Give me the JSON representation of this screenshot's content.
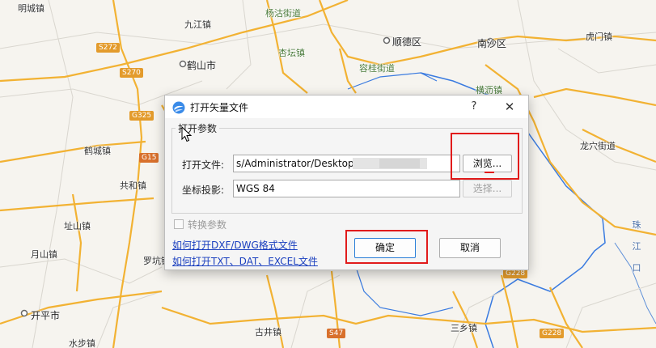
{
  "map": {
    "labels": [
      {
        "text": "明城镇",
        "cls": ""
      },
      {
        "text": "九江镇",
        "cls": ""
      },
      {
        "text": "杨沽街道",
        "cls": "green"
      },
      {
        "text": "顺德区",
        "cls": "big"
      },
      {
        "text": "南沙区",
        "cls": "big"
      },
      {
        "text": "虎门镇",
        "cls": ""
      },
      {
        "text": "鹤山市",
        "cls": "big"
      },
      {
        "text": "杏坛镇",
        "cls": "green"
      },
      {
        "text": "容桂街道",
        "cls": "green"
      },
      {
        "text": "横沥镇",
        "cls": "green"
      },
      {
        "text": "鹤城镇",
        "cls": ""
      },
      {
        "text": "共和镇",
        "cls": ""
      },
      {
        "text": "址山镇",
        "cls": ""
      },
      {
        "text": "月山镇",
        "cls": ""
      },
      {
        "text": "罗坑镇",
        "cls": ""
      },
      {
        "text": "开平市",
        "cls": "big"
      },
      {
        "text": "水步镇",
        "cls": ""
      },
      {
        "text": "古井镇",
        "cls": ""
      },
      {
        "text": "三乡镇",
        "cls": ""
      },
      {
        "text": "龙穴街道",
        "cls": ""
      },
      {
        "text": "珠 江 口",
        "cls": "river"
      }
    ],
    "shields": [
      {
        "text": "S272",
        "cls": ""
      },
      {
        "text": "S270",
        "cls": ""
      },
      {
        "text": "G325",
        "cls": ""
      },
      {
        "text": "G15",
        "cls": "red"
      },
      {
        "text": "S47",
        "cls": "red"
      },
      {
        "text": "G228",
        "cls": ""
      },
      {
        "text": "G228",
        "cls": ""
      }
    ]
  },
  "dialog": {
    "title": "打开矢量文件",
    "help": "?",
    "close": "✕",
    "group_legend": "打开参数",
    "file_label": "打开文件:",
    "file_value": "s/Administrator/Desktop/                       .bmv",
    "browse_label": "浏览...",
    "proj_label": "坐标投影:",
    "proj_value": "WGS 84",
    "select_label": "选择...",
    "convert_label": "转换参数",
    "link1": "如何打开DXF/DWG格式文件",
    "link2": "如何打开TXT、DAT、EXCEL文件",
    "ok_label": "确定",
    "cancel_label": "取消"
  },
  "colors": {
    "annotation": "#e11b1b",
    "link": "#1a3fbf",
    "road": "#f2b233",
    "boundary": "#3a7be0"
  }
}
